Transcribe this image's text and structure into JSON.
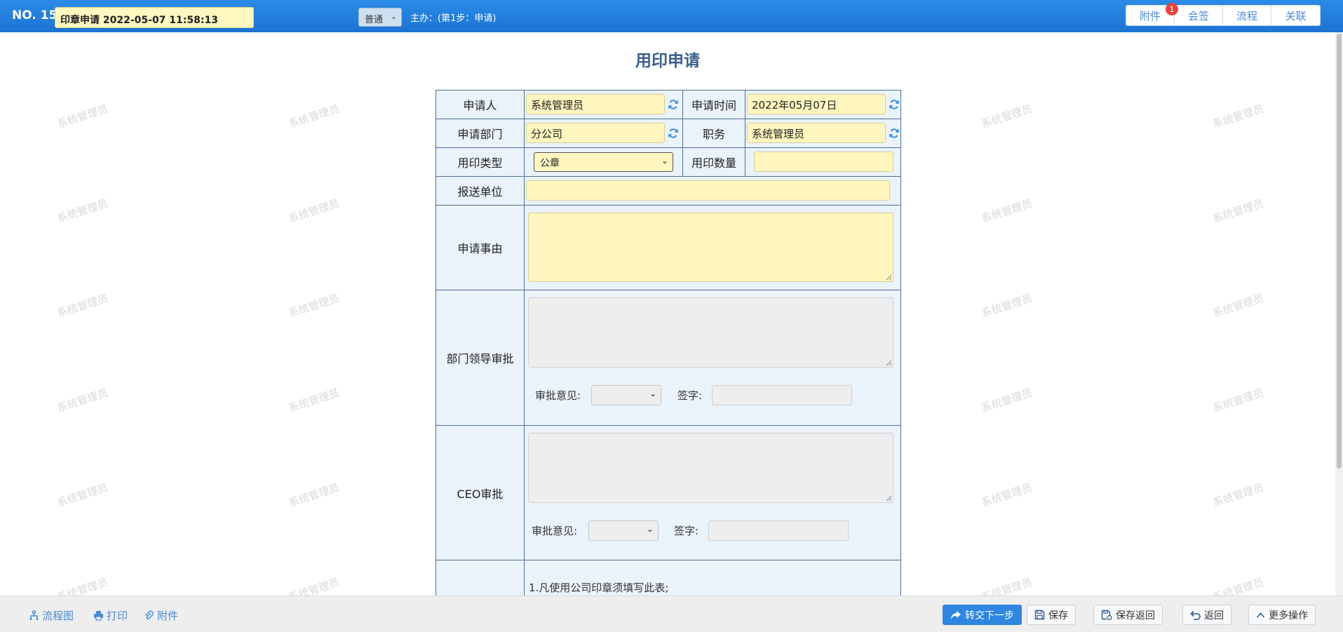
{
  "header": {
    "doc_no": "NO. 15",
    "title_value": "印章申请 2022-05-07 11:58:13",
    "priority": "普通",
    "step_info": "主办：(第1步：申请)",
    "buttons": [
      {
        "label": "附件",
        "badge": "1"
      },
      {
        "label": "会签"
      },
      {
        "label": "流程"
      },
      {
        "label": "关联"
      }
    ]
  },
  "watermark_text": "系统管理员",
  "form": {
    "title": "用印申请",
    "applicant_label": "申请人",
    "applicant_value": "系统管理员",
    "apply_time_label": "申请时间",
    "apply_time_value": "2022年05月07日",
    "dept_label": "申请部门",
    "dept_value": "分公司",
    "position_label": "职务",
    "position_value": "系统管理员",
    "seal_type_label": "用印类型",
    "seal_type_value": "公章",
    "seal_qty_label": "用印数量",
    "seal_qty_value": "",
    "send_unit_label": "报送单位",
    "send_unit_value": "",
    "reason_label": "申请事由",
    "reason_value": "",
    "dept_leader_label": "部门领导审批",
    "opinion_label": "审批意见:",
    "sign_label": "签字:",
    "ceo_label": "CEO审批",
    "notes_line1": "1.凡使用公司印章须填写此表;"
  },
  "footer": {
    "left_links": [
      "流程图",
      "打印",
      "附件"
    ],
    "buttons": [
      "转交下一步",
      "保存",
      "保存返回",
      "返回",
      "更多操作"
    ]
  },
  "colors": {
    "topbar": "#1c73d3",
    "form_border": "#4e6f96",
    "input_yellow": "#fff5bf",
    "label_bg": "#eaf2fa",
    "primary_button": "#2f86e0"
  }
}
